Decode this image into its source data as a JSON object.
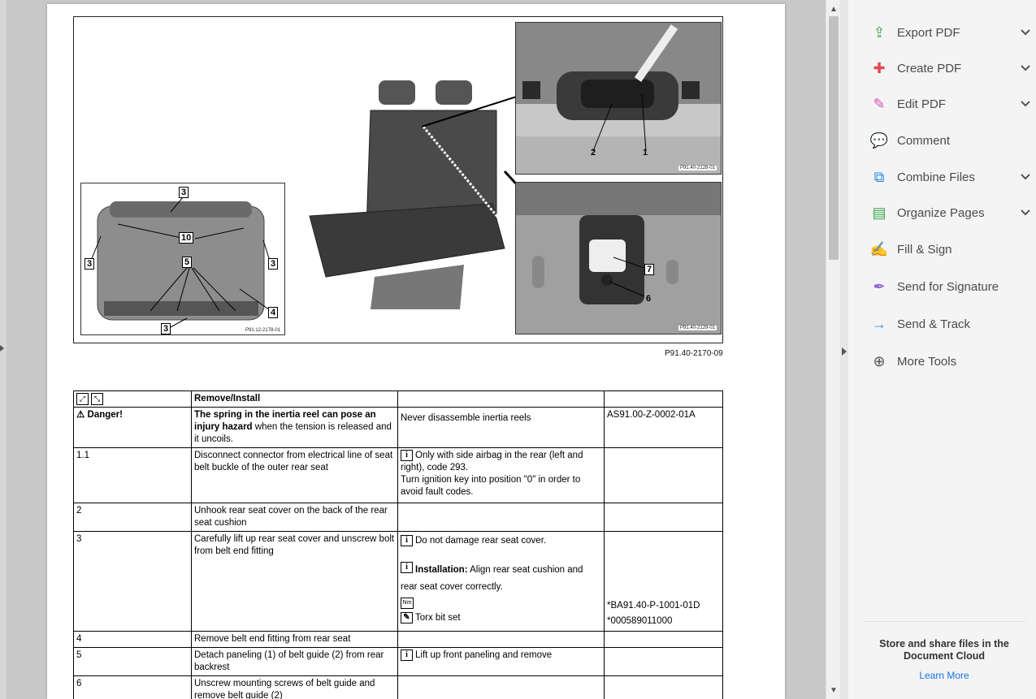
{
  "figure": {
    "caption": "P91.40-2170-09",
    "left_inset": {
      "label": "P91.12-2178-01",
      "callouts": [
        "3",
        "10",
        "3",
        "3",
        "5",
        "4",
        "3"
      ]
    },
    "top_right_inset": {
      "label": "P91.40-2128-01",
      "callouts": [
        "2",
        "1"
      ]
    },
    "bottom_right_inset": {
      "label": "P91.40-2129-01",
      "callouts": [
        "7",
        "6"
      ]
    }
  },
  "table": {
    "header": {
      "col2": "Remove/Install"
    },
    "danger": {
      "label": "Danger!",
      "text_bold": "The spring in the inertia reel can pose an injury hazard",
      "text_rest": " when the tension is released and it uncoils.",
      "note": "Never disassemble inertia reels",
      "ref": "AS91.00-Z-0002-01A"
    },
    "rows": [
      {
        "num": "1.1",
        "step": "Disconnect connector from electrical line of seat belt buckle of the outer rear seat",
        "note1": "Only with side airbag in the rear (left and right), code 293.",
        "note2": "Turn ignition key into position \"0\" in order to avoid fault codes.",
        "ref": ""
      },
      {
        "num": "2",
        "step": "Unhook rear seat cover on the back of the rear seat cushion"
      },
      {
        "num": "3",
        "step": "Carefully lift up rear seat cover and unscrew bolt from belt end fitting",
        "note1": "Do not damage rear seat cover.",
        "install_label": "Installation:",
        "install_text": " Align rear seat cushion and rear seat cover correctly.",
        "nm_label": "Nm",
        "tool_text": "Torx bit set",
        "ref1": "*BA91.40-P-1001-01D",
        "ref2": "*000589011000"
      },
      {
        "num": "4",
        "step": "Remove belt end fitting from rear seat"
      },
      {
        "num": "5",
        "step": "Detach paneling (1) of belt guide (2) from rear backrest",
        "note1": "Lift up front paneling and remove"
      },
      {
        "num": "6",
        "step": "Unscrew mounting screws of belt guide and remove belt guide (2)"
      }
    ]
  },
  "tools": [
    {
      "label": "Export PDF",
      "icon": "export-pdf-icon",
      "color": "#3da74e",
      "chevron": true
    },
    {
      "label": "Create PDF",
      "icon": "create-pdf-icon",
      "color": "#e34850",
      "chevron": true
    },
    {
      "label": "Edit PDF",
      "icon": "edit-pdf-icon",
      "color": "#d94fb1",
      "chevron": true
    },
    {
      "label": "Comment",
      "icon": "comment-icon",
      "color": "#f0c330",
      "chevron": false
    },
    {
      "label": "Combine Files",
      "icon": "combine-files-icon",
      "color": "#2d8ae6",
      "chevron": true
    },
    {
      "label": "Organize Pages",
      "icon": "organize-pages-icon",
      "color": "#3da74e",
      "chevron": true
    },
    {
      "label": "Fill & Sign",
      "icon": "fill-sign-icon",
      "color": "#8c63d6",
      "chevron": false
    },
    {
      "label": "Send for Signature",
      "icon": "send-signature-icon",
      "color": "#8c63d6",
      "chevron": false
    },
    {
      "label": "Send & Track",
      "icon": "send-track-icon",
      "color": "#2d8ae6",
      "chevron": false
    },
    {
      "label": "More Tools",
      "icon": "more-tools-icon",
      "color": "#555555",
      "chevron": false
    }
  ],
  "cloud": {
    "text": "Store and share files in the Document Cloud",
    "link": "Learn More"
  }
}
